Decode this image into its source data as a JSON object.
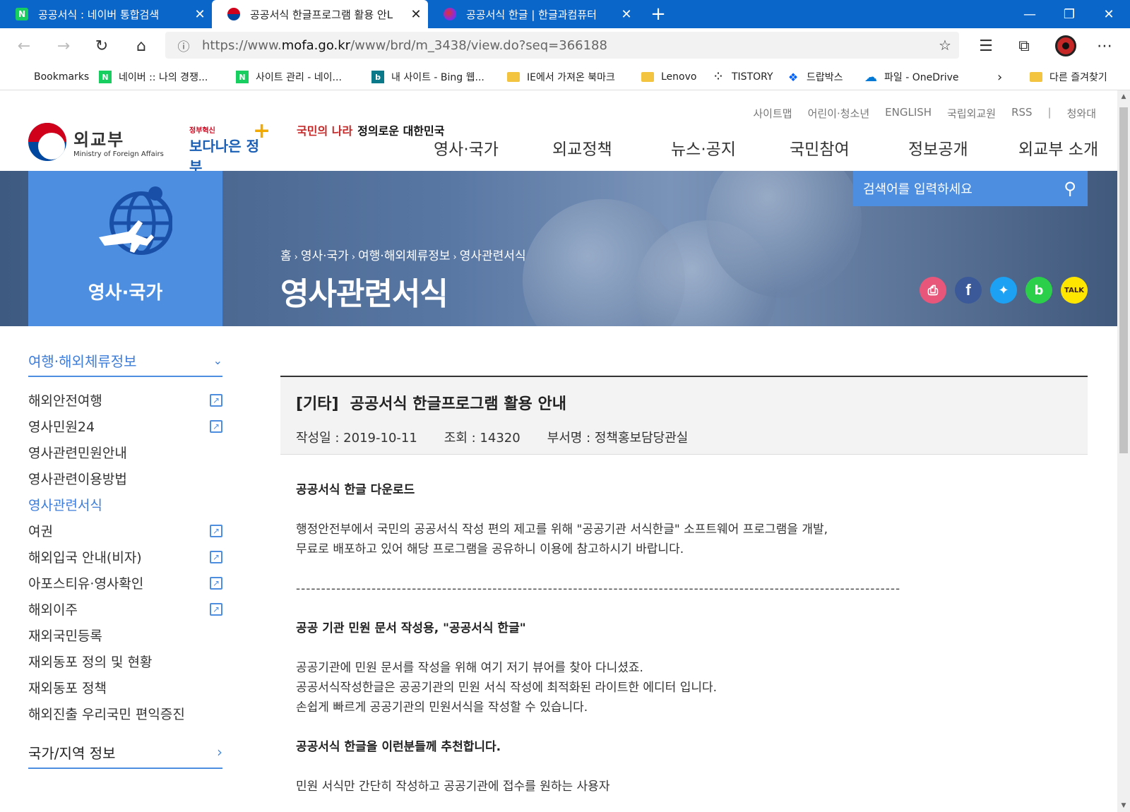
{
  "browser": {
    "tabs": [
      {
        "title": "공공서식 : 네이버 통합검색",
        "favicon": "naver-icon"
      },
      {
        "title": "공공서식 한글프로그램 활용 안L",
        "favicon": "korea-flag-icon"
      },
      {
        "title": "공공서식 한글 | 한글과컴퓨터",
        "favicon": "hancom-icon"
      }
    ],
    "url_prefix": "https://www.",
    "url_domain": "mofa.go.kr",
    "url_path": "/www/brd/m_3438/view.do?seq=366188",
    "bookmarks": [
      {
        "label": "Bookmarks",
        "icon": "none"
      },
      {
        "label": "네이버 :: 나의 경쟁...",
        "icon": "naver-icon"
      },
      {
        "label": "사이트 관리 - 네이...",
        "icon": "naver-icon"
      },
      {
        "label": "내 사이트 - Bing 웹...",
        "icon": "bing-icon"
      },
      {
        "label": "IE에서 가져온 북마크",
        "icon": "folder-icon"
      },
      {
        "label": "Lenovo",
        "icon": "folder-icon"
      },
      {
        "label": "TISTORY",
        "icon": "tistory-icon"
      },
      {
        "label": "드랍박스",
        "icon": "dropbox-icon"
      },
      {
        "label": "파일 - OneDrive",
        "icon": "onedrive-icon"
      },
      {
        "label": "다른 즐겨찾기",
        "icon": "folder-icon"
      }
    ]
  },
  "site": {
    "util_links": [
      "사이트맵",
      "어린이·청소년",
      "ENGLISH",
      "국립외교원",
      "RSS",
      "청와대"
    ],
    "logo_ko": "외교부",
    "logo_en": "Ministry of Foreign Affairs",
    "badge1_small": "정부혁신",
    "badge1_main": "보다나은 정부",
    "badge2_a": "국민의 나라",
    "badge2_b": "정의로운 대한민국",
    "gnb": [
      "영사·국가",
      "외교정책",
      "뉴스·공지",
      "국민참여",
      "정보공개",
      "외교부 소개"
    ],
    "search_placeholder": "검색어를 입력하세요",
    "side_label": "영사·국가",
    "breadcrumb": [
      "홈",
      "영사·국가",
      "여행·해외체류정보",
      "영사관련서식"
    ],
    "page_title": "영사관련서식",
    "share": [
      "print-icon",
      "facebook-icon",
      "twitter-icon",
      "band-icon",
      "kakaotalk-icon"
    ]
  },
  "lnb": {
    "head": "여행·해외체류정보",
    "items": [
      {
        "label": "해외안전여행",
        "external": true
      },
      {
        "label": "영사민원24",
        "external": true
      },
      {
        "label": "영사관련민원안내",
        "external": false
      },
      {
        "label": "영사관련이용방법",
        "external": false
      },
      {
        "label": "영사관련서식",
        "external": false,
        "active": true
      },
      {
        "label": "여권",
        "external": true
      },
      {
        "label": "해외입국 안내(비자)",
        "external": true
      },
      {
        "label": "아포스티유·영사확인",
        "external": true
      },
      {
        "label": "해외이주",
        "external": true
      },
      {
        "label": "재외국민등록",
        "external": false
      },
      {
        "label": "재외동포 정의 및 현황",
        "external": false
      },
      {
        "label": "재외동포 정책",
        "external": false
      },
      {
        "label": "해외진출 우리국민 편익증진",
        "external": false
      }
    ],
    "head2": "국가/지역 정보"
  },
  "article": {
    "category": "[기타]",
    "title": "공공서식 한글프로그램 활용 안내",
    "date": "작성일 : 2019-10-11",
    "views": "조회 : 14320",
    "dept": "부서명 : 정책홍보담당관실",
    "h1": "공공서식 한글 다운로드",
    "p1a": "행정안전부에서 국민의 공공서식 작성 편의 제고를 위해 \"공공기관 서식한글\" 소프트웨어 프로그램을 개발,",
    "p1b": "무료로 배포하고 있어 해당 프로그램을 공유하니 이용에 참고하시기 바랍니다.",
    "dashes": "------------------------------------------------------------------------------------------------------------------------",
    "h2": "공공 기관 민원 문서 작성용, \"공공서식 한글\"",
    "p2a": "공공기관에 민원 문서를 작성을 위해 여기 저기 뷰어를 찾아 다니셨죠.",
    "p2b": "공공서식작성한글은 공공기관의 민원 서식 작성에 최적화된 라이트한 에디터 입니다.",
    "p2c": "손쉽게 빠르게 공공기관의 민원서식을 작성할 수 있습니다.",
    "h3": "공공서식 한글을 이런분들께 추천합니다.",
    "p3a": "민원 서식만 간단히 작성하고 공공기관에 접수를 원하는 사용자"
  }
}
